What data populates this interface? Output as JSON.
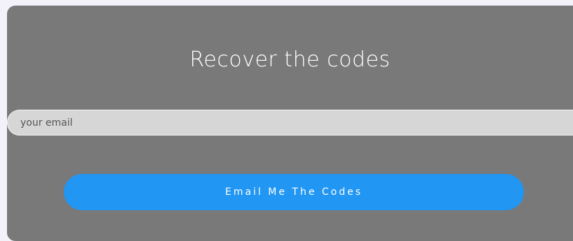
{
  "form": {
    "title": "Recover the codes",
    "email_placeholder": "your email",
    "submit_label": "Email Me The Codes"
  },
  "colors": {
    "card_background": "#797979",
    "input_background": "#d6d6d6",
    "button_background": "#2196f3",
    "page_background": "#f3f2fa"
  }
}
